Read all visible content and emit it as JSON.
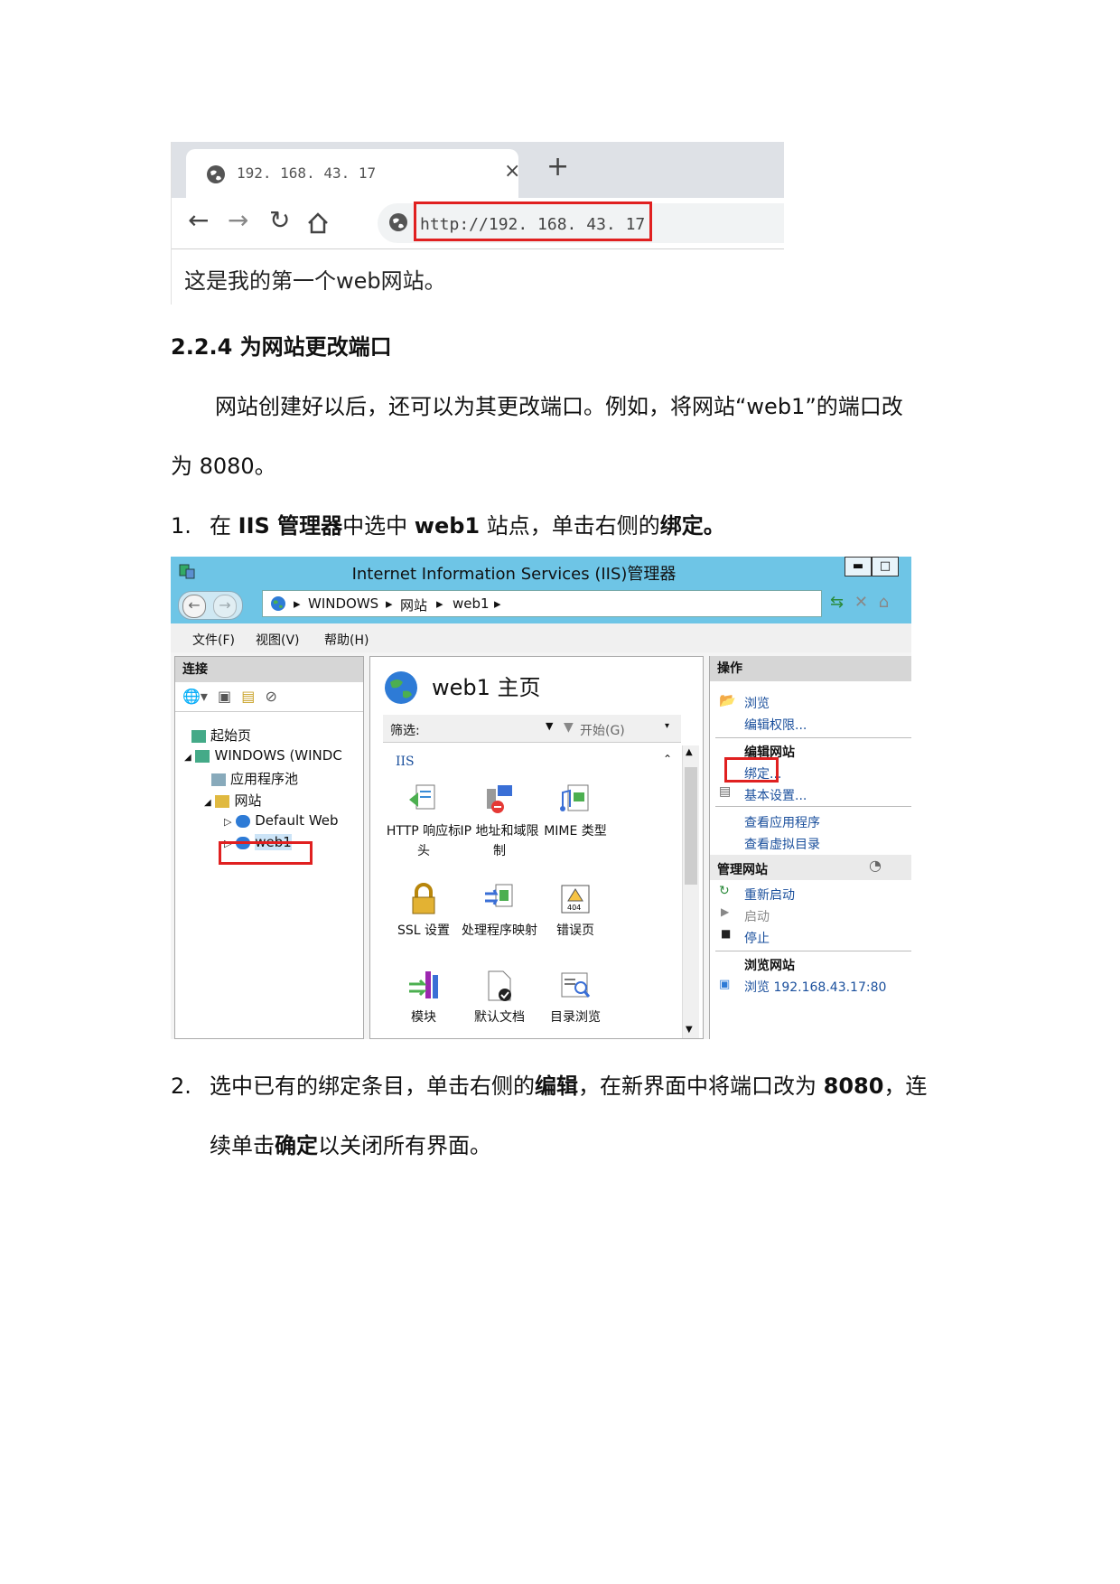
{
  "browser": {
    "tab_title": "192. 168. 43. 17",
    "tab_close": "×",
    "new_tab": "+",
    "url": "http://192. 168. 43. 17",
    "page_content": "这是我的第一个web网站。"
  },
  "doc": {
    "heading": "2.2.4  为网站更改端口",
    "para1_line1": "网站创建好以后，还可以为其更改端口。例如，将网站“web1”的端口改",
    "para1_line2": "为 8080。",
    "step1": {
      "num": "1.",
      "t1": "在 ",
      "b1": "IIS 管理器",
      "t2": "中选中 ",
      "b2": "web1",
      "t3": " 站点，单击右侧的",
      "b3": "绑定。"
    },
    "step2": {
      "num": "2.",
      "t1": "选中已有的绑定条目，单击右侧的",
      "b1": "编辑",
      "t2": "，在新界面中将端口改为 ",
      "b2": "8080",
      "t3": "，连",
      "t4": "续单击",
      "b3": "确定",
      "t5": "以关闭所有界面。"
    }
  },
  "iis": {
    "title": "Internet Information Services (IIS)管理器",
    "breadcrumb": [
      "WINDOWS",
      "网站",
      "web1"
    ],
    "menu": [
      "文件(F)",
      "视图(V)",
      "帮助(H)"
    ],
    "connections": {
      "header": "连接",
      "tree": [
        "起始页",
        "WINDOWS (WINDC",
        "应用程序池",
        "网站",
        "Default Web",
        "web1"
      ]
    },
    "home": {
      "title": "web1 主页",
      "filter_label": "筛选:",
      "start_label": "开始(G)",
      "group": "IIS",
      "features": [
        "HTTP 响应标头",
        "IP 地址和域限制",
        "MIME 类型",
        "SSL 设置",
        "处理程序映射",
        "错误页",
        "模块",
        "默认文档",
        "目录浏览"
      ]
    },
    "actions": {
      "header": "操作",
      "browse": "浏览",
      "edit_permissions": "编辑权限...",
      "edit_site_header": "编辑网站",
      "bindings": "绑定...",
      "basic_settings": "基本设置...",
      "view_apps": "查看应用程序",
      "view_vdirs": "查看虚拟目录",
      "manage_site_header": "管理网站",
      "restart": "重新启动",
      "start": "启动",
      "stop": "停止",
      "browse_site_header": "浏览网站",
      "browse_url": "浏览 192.168.43.17:80"
    }
  },
  "colors": {
    "highlight": "#e02020",
    "iis_titlebar": "#6ec5e6",
    "link": "#1a4f9c"
  }
}
